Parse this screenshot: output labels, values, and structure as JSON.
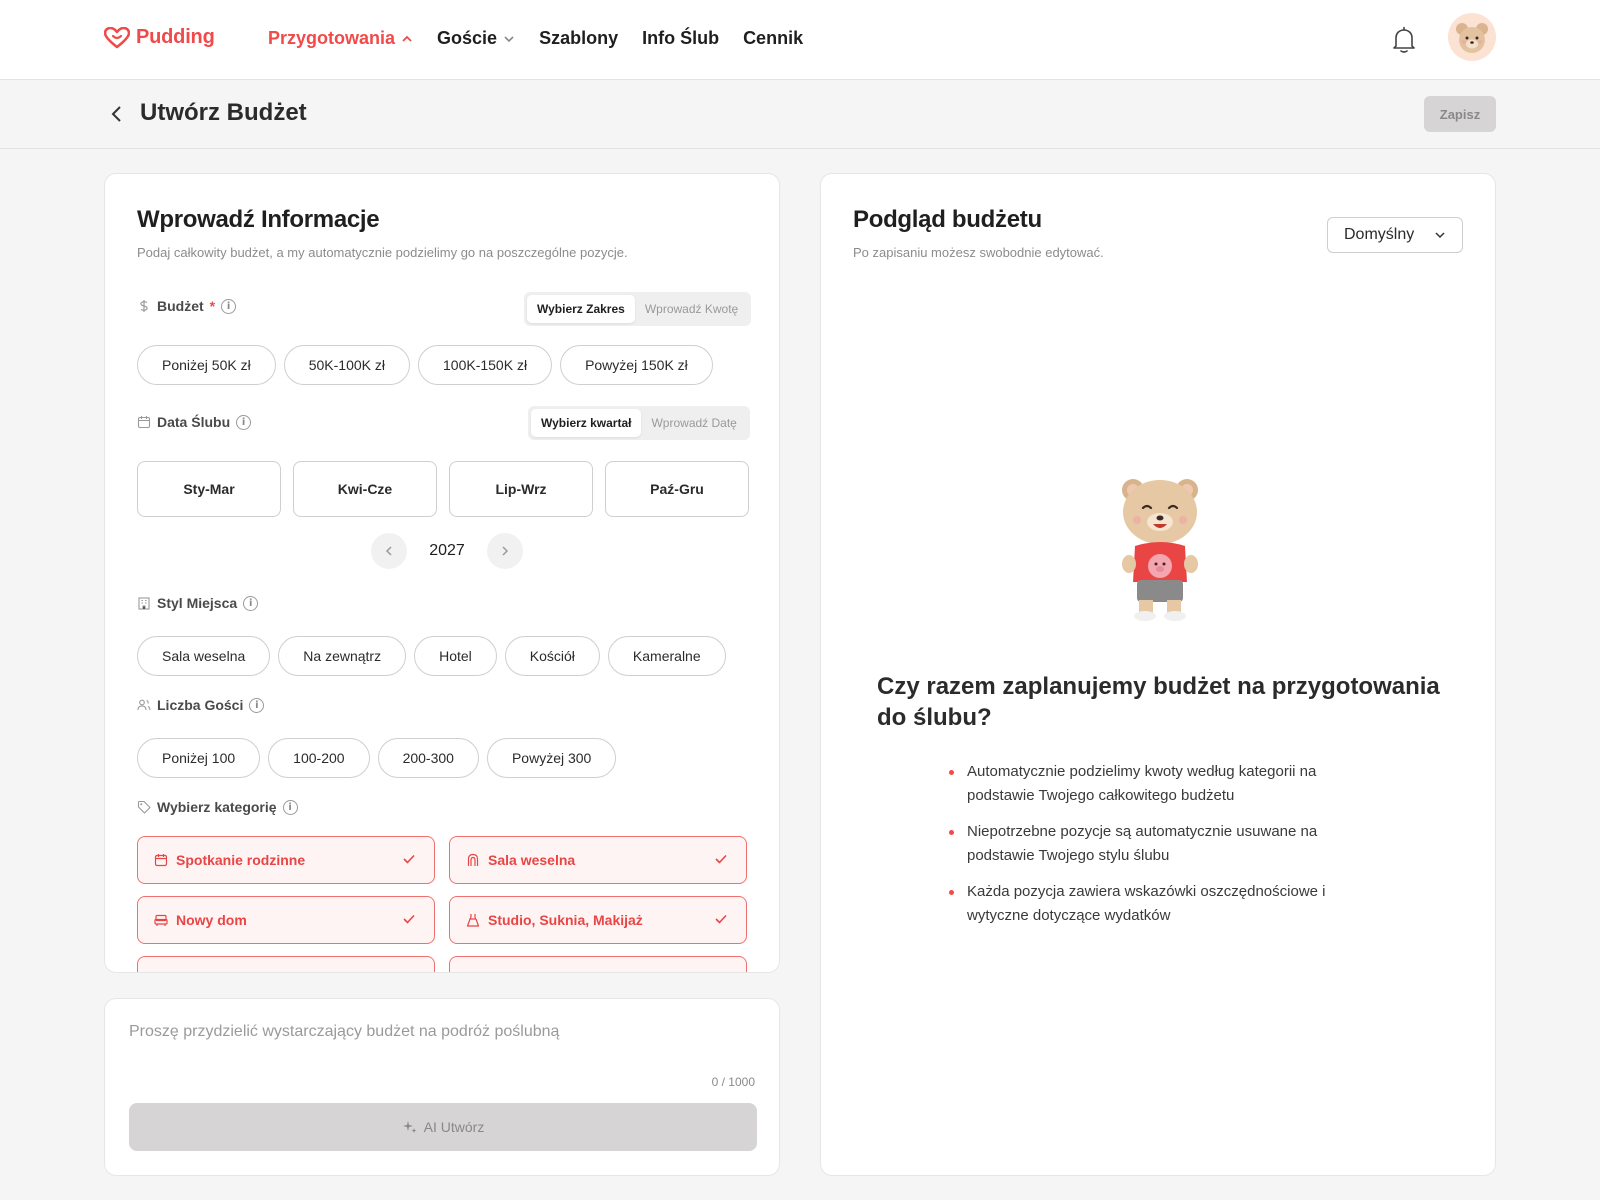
{
  "brand": {
    "name": "Pudding",
    "color": "#f04a4a",
    "logo_icon": "heart-icon"
  },
  "nav": {
    "items": [
      {
        "label": "Przygotowania",
        "active": true,
        "icon": "chevron-up-icon"
      },
      {
        "label": "Goście",
        "active": false,
        "icon": "chevron-down-icon"
      },
      {
        "label": "Szablony",
        "active": false
      },
      {
        "label": "Info Ślub",
        "active": false
      },
      {
        "label": "Cennik",
        "active": false
      }
    ],
    "notification_icon": "bell-icon",
    "avatar_icon": "bear-avatar-icon"
  },
  "subheader": {
    "title": "Utwórz Budżet",
    "save_label": "Zapisz"
  },
  "form": {
    "title": "Wprowadź Informacje",
    "subtitle": "Podaj całkowity budżet, a my automatycznie podzielimy go na poszczególne pozycje.",
    "budget": {
      "label": "Budżet",
      "required_mark": "*",
      "toggle": [
        "Wybierz Zakres",
        "Wprowadź Kwotę"
      ],
      "toggle_selected": "Wybierz Zakres",
      "options": [
        "Poniżej 50K zł",
        "50K-100K zł",
        "100K-150K zł",
        "Powyżej 150K zł"
      ]
    },
    "date": {
      "label": "Data Ślubu",
      "toggle": [
        "Wybierz kwartał",
        "Wprowadź Datę"
      ],
      "toggle_selected": "Wybierz kwartał",
      "quarters": [
        "Sty-Mar",
        "Kwi-Cze",
        "Lip-Wrz",
        "Paź-Gru"
      ],
      "year": "2027"
    },
    "venue": {
      "label": "Styl Miejsca",
      "options": [
        "Sala weselna",
        "Na zewnątrz",
        "Hotel",
        "Kościół",
        "Kameralne"
      ]
    },
    "guests": {
      "label": "Liczba Gości",
      "options": [
        "Poniżej 100",
        "100-200",
        "200-300",
        "Powyżej 300"
      ]
    },
    "categories": {
      "label": "Wybierz kategorię",
      "items": [
        {
          "label": "Spotkanie rodzinne",
          "icon": "calendar-icon",
          "checked": true
        },
        {
          "label": "Sala weselna",
          "icon": "arch-icon",
          "checked": true
        },
        {
          "label": "Nowy dom",
          "icon": "sofa-icon",
          "checked": true
        },
        {
          "label": "Studio, Suknia, Makijaż",
          "icon": "dress-icon",
          "checked": true
        },
        {
          "label": "",
          "icon": "",
          "checked": true
        },
        {
          "label": "",
          "icon": "",
          "checked": true
        }
      ]
    }
  },
  "prompt": {
    "placeholder": "Proszę przydzielić wystarczający budżet na podróż poślubną",
    "counter": "0 / 1000",
    "ai_button": "AI Utwórz"
  },
  "preview": {
    "title": "Podgląd budżetu",
    "subtitle": "Po zapisaniu możesz swobodnie edytować.",
    "dropdown_value": "Domyślny",
    "promo_title": "Czy razem zaplanujemy budżet na przygotowania do ślubu?",
    "bullets": [
      "Automatycznie podzielimy kwoty według kategorii na podstawie Twojego całkowitego budżetu",
      "Niepotrzebne pozycje są automatycznie usuwane na podstawie Twojego stylu ślubu",
      "Każda pozycja zawiera wskazówki oszczędnościowe i wytyczne dotyczące wydatków"
    ]
  },
  "colors": {
    "accent": "#f04a4a",
    "category_bg": "#fff4f4",
    "disabled_bg": "#d6d4d4"
  }
}
